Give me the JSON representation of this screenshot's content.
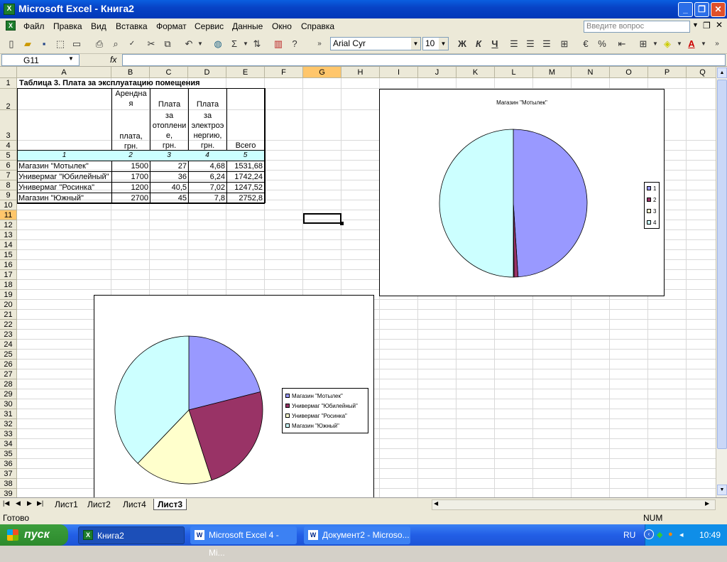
{
  "window": {
    "title": "Microsoft Excel - Книга2"
  },
  "menu": {
    "items": [
      "Файл",
      "Правка",
      "Вид",
      "Вставка",
      "Формат",
      "Сервис",
      "Данные",
      "Окно",
      "Справка"
    ],
    "help_placeholder": "Введите вопрос"
  },
  "toolbar": {
    "font_name": "Arial Cyr",
    "font_size": "10",
    "bold_label": "Ж",
    "italic_label": "К",
    "underline_label": "Ч",
    "sum_label": "Σ",
    "percent_label": "%"
  },
  "formula_bar": {
    "name_box": "G11",
    "fx_label": "fx",
    "formula": ""
  },
  "columns": [
    "A",
    "B",
    "C",
    "D",
    "E",
    "F",
    "G",
    "H",
    "I",
    "J",
    "K",
    "L",
    "M",
    "N",
    "O",
    "P",
    "Q"
  ],
  "rows": [
    "1",
    "2",
    "3",
    "4",
    "5",
    "6",
    "7",
    "8",
    "9",
    "10",
    "11",
    "12",
    "13",
    "14",
    "15",
    "16",
    "17",
    "18",
    "19",
    "20",
    "21",
    "22",
    "23",
    "24",
    "25",
    "26",
    "27",
    "28",
    "29",
    "30",
    "31",
    "32",
    "33",
    "34",
    "35",
    "36",
    "37",
    "38",
    "39"
  ],
  "table": {
    "title": "Таблица 3. Плата за эксплуатацию помещения",
    "h_b": [
      "Арендна",
      "я",
      "",
      "плата,",
      "грн."
    ],
    "h_c": [
      "Плата",
      "за",
      "отоплени",
      "е,",
      "грн."
    ],
    "h_d": [
      "Плата",
      "за",
      "электроэ",
      "нергию,",
      "грн."
    ],
    "h_e": "Всего",
    "num_row": [
      "1",
      "2",
      "3",
      "4",
      "5"
    ],
    "data": [
      [
        "Магазин \"Мотылек\"",
        "1500",
        "27",
        "4,68",
        "1531,68"
      ],
      [
        "Универмаг \"Юбилейный\"",
        "1700",
        "36",
        "6,24",
        "1742,24"
      ],
      [
        "Универмаг \"Росинка\"",
        "1200",
        "40,5",
        "7,02",
        "1247,52"
      ],
      [
        "Магазин \"Южный\"",
        "2700",
        "45",
        "7,8",
        "2752,8"
      ]
    ]
  },
  "chart_data": [
    {
      "type": "pie",
      "title": "Магазин \"Мотылек\"",
      "categories": [
        "1",
        "2",
        "3",
        "4"
      ],
      "values": [
        1500,
        27,
        4.68,
        1531.68
      ],
      "colors": [
        "#9999ff",
        "#993366",
        "#ffffcc",
        "#ccffff"
      ],
      "legend": "right"
    },
    {
      "type": "pie",
      "title": "",
      "categories": [
        "Магазин \"Мотылек\"",
        "Универмаг \"Юбилейный\"",
        "Универмаг \"Росинка\"",
        "Магазин \"Южный\""
      ],
      "values": [
        1531.68,
        1742.24,
        1247.52,
        2752.8
      ],
      "colors": [
        "#9999ff",
        "#993366",
        "#ffffcc",
        "#ccffff"
      ],
      "legend": "right"
    }
  ],
  "sheet_tabs": {
    "items": [
      "Лист1",
      "Лист2",
      "Лист4",
      "Лист3"
    ],
    "active": "Лист3"
  },
  "status": {
    "left": "Готово",
    "mode": "NUM"
  },
  "taskbar": {
    "start": "пуск",
    "tasks": [
      "Книга2",
      "Microsoft Excel 4 - Mi...",
      "Документ2 - Microso..."
    ],
    "lang": "RU",
    "clock": "10:49"
  }
}
